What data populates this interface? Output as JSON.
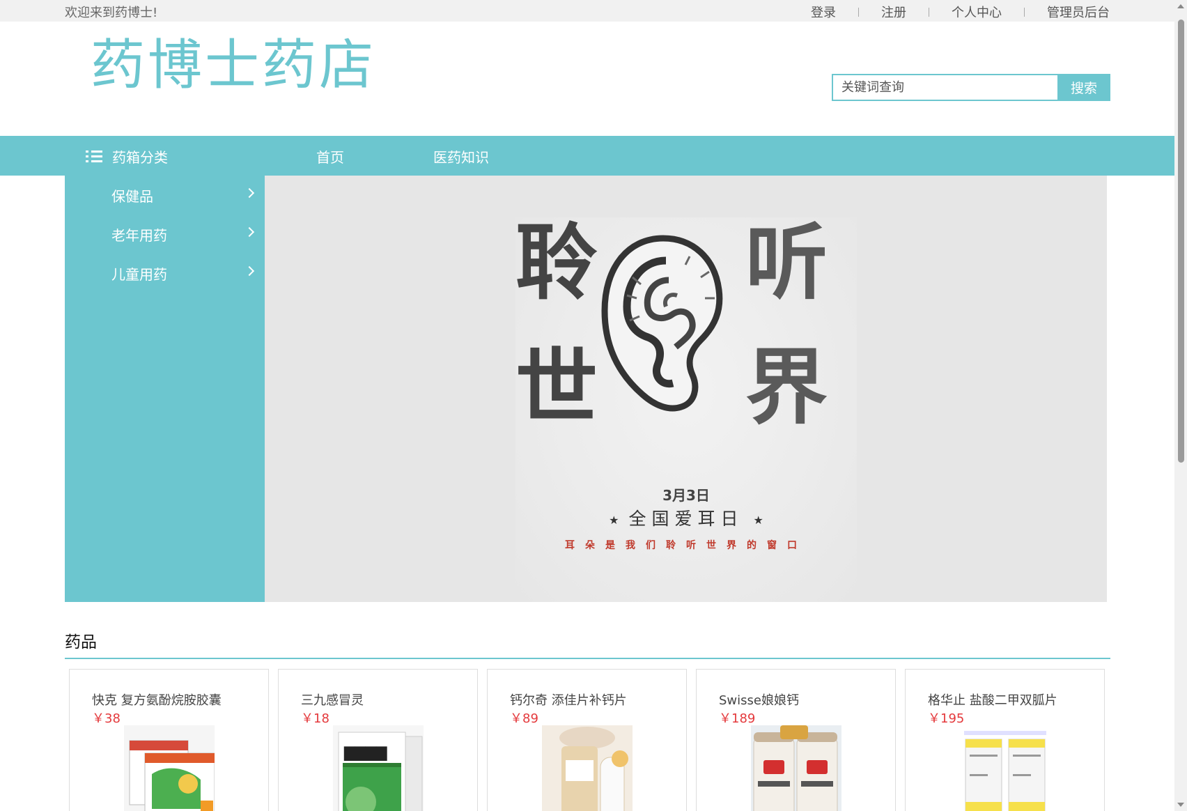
{
  "topbar": {
    "welcome": "欢迎来到药博士!",
    "links": [
      "登录",
      "注册",
      "个人中心",
      "管理员后台"
    ]
  },
  "header": {
    "logo": "药博士药店",
    "search_placeholder": "关键词查询",
    "search_button": "搜索"
  },
  "nav": {
    "category_title": "药箱分类",
    "items": [
      "首页",
      "医药知识"
    ]
  },
  "sidebar": {
    "items": [
      "保健品",
      "老年用药",
      "儿童用药"
    ]
  },
  "banner": {
    "chars": [
      "聆",
      "听",
      "世",
      "界"
    ],
    "date": "3月3日",
    "festival": "全国爱耳日",
    "star": "★",
    "tagline": "耳朵是我们聆听世界的窗口"
  },
  "products": {
    "title": "药品",
    "items": [
      {
        "name": "快克 复方氨酚烷胺胶囊",
        "price": "￥38"
      },
      {
        "name": "三九感冒灵",
        "price": "￥18"
      },
      {
        "name": "钙尔奇 添佳片补钙片",
        "price": "￥89"
      },
      {
        "name": "Swisse娘娘钙",
        "price": "￥189"
      },
      {
        "name": "格华止 盐酸二甲双胍片",
        "price": "￥195"
      }
    ]
  },
  "colors": {
    "accent": "#6cc6cf",
    "price": "#e4393c",
    "topbar_bg": "#f1f1f1",
    "banner_bg": "#e6e6e6"
  }
}
